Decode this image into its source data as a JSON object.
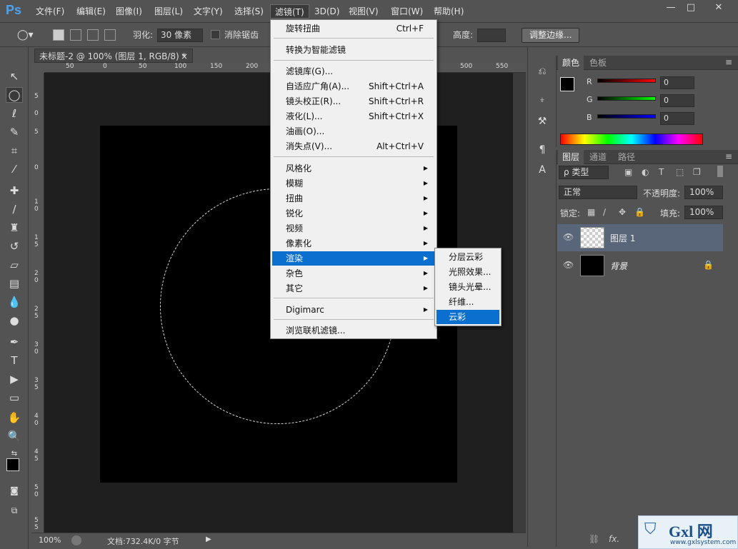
{
  "app": {
    "logo": "Ps"
  },
  "menubar": {
    "items": [
      "文件(F)",
      "编辑(E)",
      "图像(I)",
      "图层(L)",
      "文字(Y)",
      "选择(S)",
      "滤镜(T)",
      "3D(D)",
      "视图(V)",
      "窗口(W)",
      "帮助(H)"
    ],
    "active_index": 6
  },
  "window_controls": {
    "minimize": "—",
    "maximize": "□",
    "close": "✕"
  },
  "options": {
    "feather_label": "羽化:",
    "feather_value": "30 像素",
    "antialias_label": "消除锯齿",
    "height_label": "高度:",
    "refine_edge_label": "调整边缘..."
  },
  "document": {
    "tab_title": "未标题-2 @ 100% (图层 1, RGB/8) *",
    "tab_close": "×",
    "ruler_h": [
      "50",
      "0",
      "50",
      "100",
      "150",
      "200",
      "500",
      "550"
    ],
    "ruler_v": [
      "5",
      "0",
      "5",
      "0",
      "1 0",
      "1 5",
      "2 0",
      "2 5",
      "3 0",
      "3 5",
      "4 0",
      "4 5",
      "5 0",
      "5 5"
    ]
  },
  "status": {
    "zoom": "100%",
    "doc_info": "文档:732.4K/0 字节"
  },
  "filter_menu": {
    "items": [
      {
        "label": "旋转扭曲",
        "shortcut": "Ctrl+F"
      },
      {
        "label": "转换为智能滤镜",
        "shortcut": ""
      },
      {
        "label": "滤镜库(G)...",
        "shortcut": ""
      },
      {
        "label": "自适应广角(A)...",
        "shortcut": "Shift+Ctrl+A"
      },
      {
        "label": "镜头校正(R)...",
        "shortcut": "Shift+Ctrl+R"
      },
      {
        "label": "液化(L)...",
        "shortcut": "Shift+Ctrl+X"
      },
      {
        "label": "油画(O)...",
        "shortcut": ""
      },
      {
        "label": "消失点(V)...",
        "shortcut": "Alt+Ctrl+V"
      },
      {
        "label": "风格化",
        "shortcut": ""
      },
      {
        "label": "模糊",
        "shortcut": ""
      },
      {
        "label": "扭曲",
        "shortcut": ""
      },
      {
        "label": "锐化",
        "shortcut": ""
      },
      {
        "label": "视频",
        "shortcut": ""
      },
      {
        "label": "像素化",
        "shortcut": ""
      },
      {
        "label": "渲染",
        "shortcut": ""
      },
      {
        "label": "杂色",
        "shortcut": ""
      },
      {
        "label": "其它",
        "shortcut": ""
      },
      {
        "label": "Digimarc",
        "shortcut": ""
      },
      {
        "label": "浏览联机滤镜...",
        "shortcut": ""
      }
    ],
    "highlighted_index": 14
  },
  "render_submenu": {
    "items": [
      "分层云彩",
      "光照效果...",
      "镜头光晕...",
      "纤维...",
      "云彩"
    ],
    "highlighted_index": 4
  },
  "color_panel": {
    "tabs": [
      "颜色",
      "色板"
    ],
    "channels": [
      {
        "label": "R",
        "value": "0"
      },
      {
        "label": "G",
        "value": "0"
      },
      {
        "label": "B",
        "value": "0"
      }
    ]
  },
  "layers_panel": {
    "tabs": [
      "图层",
      "通道",
      "路径"
    ],
    "kind_filter": "ρ 类型",
    "blend_mode": "正常",
    "opacity_label": "不透明度:",
    "opacity_value": "100%",
    "lock_label": "锁定:",
    "fill_label": "填充:",
    "fill_value": "100%",
    "layers": [
      {
        "name": "图层 1"
      },
      {
        "name": "背景"
      }
    ],
    "footer_fx": "fx."
  },
  "watermark": {
    "brand": "Gxl 网",
    "url": "www.gxlsystem.com"
  }
}
